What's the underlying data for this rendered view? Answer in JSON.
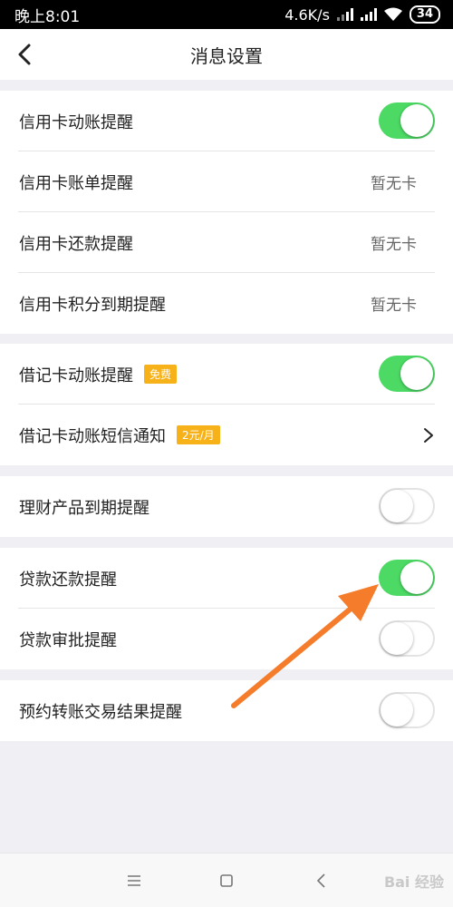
{
  "status_bar": {
    "time": "晚上8:01",
    "speed": "4.6K/s",
    "battery": "34"
  },
  "header": {
    "title": "消息设置"
  },
  "sections": [
    {
      "rows": [
        {
          "label": "信用卡动账提醒",
          "toggle": true
        },
        {
          "label": "信用卡账单提醒",
          "value": "暂无卡"
        },
        {
          "label": "信用卡还款提醒",
          "value": "暂无卡"
        },
        {
          "label": "信用卡积分到期提醒",
          "value": "暂无卡"
        }
      ]
    },
    {
      "rows": [
        {
          "label": "借记卡动账提醒",
          "badge": "免费",
          "toggle": true
        },
        {
          "label": "借记卡动账短信通知",
          "badge": "2元/月"
        }
      ]
    },
    {
      "rows": [
        {
          "label": "理财产品到期提醒",
          "toggle": false
        }
      ]
    },
    {
      "rows": [
        {
          "label": "贷款还款提醒",
          "toggle": true
        },
        {
          "label": "贷款审批提醒",
          "toggle": false
        }
      ]
    },
    {
      "rows": [
        {
          "label": "预约转账交易结果提醒",
          "toggle": false
        }
      ]
    }
  ],
  "colors": {
    "toggle_on": "#4cd964",
    "badge": "#f7b21a",
    "arrow": "#f47c2a"
  },
  "watermark": "Bai 经验"
}
